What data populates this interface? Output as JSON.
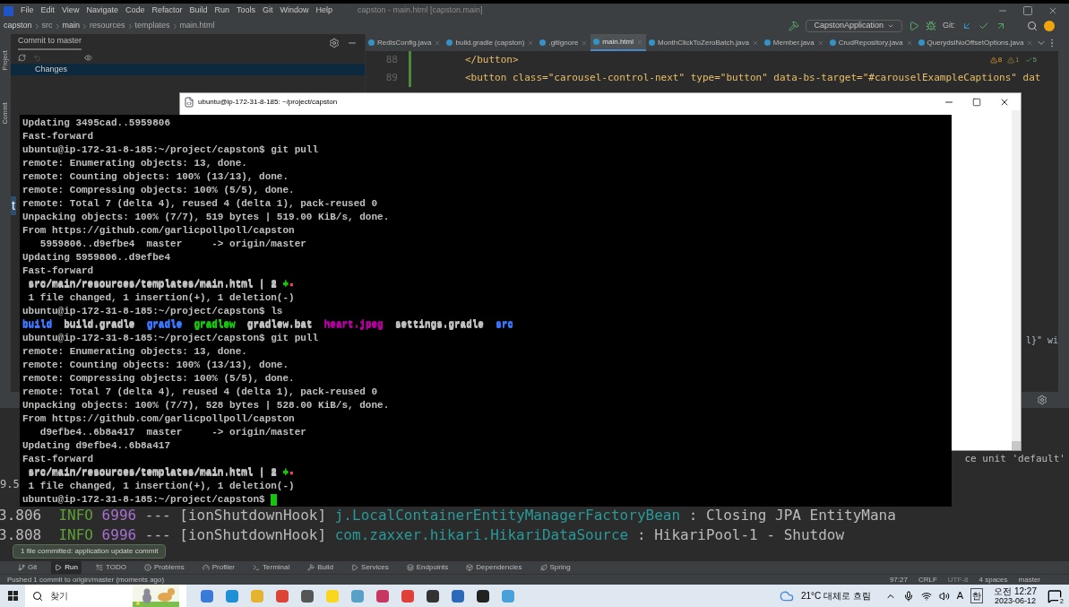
{
  "ide": {
    "menu": [
      "File",
      "Edit",
      "View",
      "Navigate",
      "Code",
      "Refactor",
      "Build",
      "Run",
      "Tools",
      "Git",
      "Window",
      "Help"
    ],
    "window_title": "capston - main.html [capston.main]",
    "breadcrumb": [
      "capston",
      "src",
      "main",
      "resources",
      "templates",
      "main.html"
    ],
    "run_config": "CapstonApplication",
    "git_label": "Git:",
    "side_tabs": [
      "Project",
      "Commit"
    ],
    "commit_panel": {
      "title": "Commit to master",
      "changes": "Changes"
    },
    "editor_tabs": [
      {
        "label": "RedisConfig.java",
        "selected": false
      },
      {
        "label": "build.gradle (capston)",
        "selected": false
      },
      {
        "label": ".gitignore",
        "selected": false
      },
      {
        "label": "main.html",
        "selected": true
      },
      {
        "label": "MonthClickToZeroBatch.java",
        "selected": false
      },
      {
        "label": "Member.java",
        "selected": false
      },
      {
        "label": "CrudRepository.java",
        "selected": false
      },
      {
        "label": "QuerydslNoOffsetOptions.java",
        "selected": false
      }
    ],
    "inspections": {
      "warnings": "8",
      "weak": "1",
      "ok": "5"
    },
    "code_lines": [
      {
        "number": "88",
        "text": "</button>"
      },
      {
        "number": "89",
        "text": "<button class=\"carousel-control-next\" type=\"button\" data-bs-target=\"#carouselExampleCaptions\" dat"
      }
    ],
    "code_fragment": "l}\" wi",
    "console_fragments": {
      "left_mark": "t",
      "unit": "ce unit 'default'",
      "time": "9.5"
    },
    "console_lines": [
      {
        "time": "3.806",
        "level": "INFO",
        "pid": "6996",
        "sep": "---",
        "thread": "[ionShutdownHook]",
        "logger": "j.LocalContainerEntityManagerFactoryBean",
        "message": ": Closing JPA EntityMana"
      },
      {
        "time": "3.808",
        "level": "INFO",
        "pid": "6996",
        "sep": "---",
        "thread": "[ionShutdownHook]",
        "logger": "com.zaxxer.hikari.HikariDataSource",
        "message": ": HikariPool-1 - Shutdow"
      }
    ],
    "tooltip": "1 file committed: application update commit",
    "tool_tabs": [
      {
        "label": "Git",
        "selected": false
      },
      {
        "label": "Run",
        "selected": true
      },
      {
        "label": "TODO",
        "selected": false
      },
      {
        "label": "Problems",
        "selected": false
      },
      {
        "label": "Profiler",
        "selected": false
      },
      {
        "label": "Terminal",
        "selected": false
      },
      {
        "label": "Build",
        "selected": false
      },
      {
        "label": "Services",
        "selected": false
      },
      {
        "label": "Endpoints",
        "selected": false
      },
      {
        "label": "Dependencies",
        "selected": false
      },
      {
        "label": "Spring",
        "selected": false
      }
    ],
    "status": {
      "message": "Pushed 1 commit to origin/master (moments ago)",
      "position": "97:27",
      "line_sep": "CRLF",
      "encoding": "UTF-8",
      "indent": "4 spaces",
      "branch": "master"
    }
  },
  "terminal": {
    "title": "ubuntu@ip-172-31-8-185: ~/project/capston",
    "lines": [
      [
        {
          "text": "Updating 3495cad..5959806"
        }
      ],
      [
        {
          "text": "Fast-forward"
        }
      ],
      [
        {
          "text": "ubuntu@ip-172-31-8-185:~/project/capston$ git pull"
        }
      ],
      [
        {
          "text": "remote: Enumerating objects: 13, done."
        }
      ],
      [
        {
          "text": "remote: Counting objects: 100% (13/13), done."
        }
      ],
      [
        {
          "text": "remote: Compressing objects: 100% (5/5), done."
        }
      ],
      [
        {
          "text": "remote: Total 7 (delta 4), reused 4 (delta 1), pack-reused 0"
        }
      ],
      [
        {
          "text": "Unpacking objects: 100% (7/7), 519 bytes | 519.00 KiB/s, done."
        }
      ],
      [
        {
          "text": "From https://github.com/garlicpollpoll/capston"
        }
      ],
      [
        {
          "text": "   5959806..d9efbe4  master     -> origin/master"
        }
      ],
      [
        {
          "text": "Updating 5959806..d9efbe4"
        }
      ],
      [
        {
          "text": "Fast-forward"
        }
      ],
      [
        {
          "text": " src/main/resources/templates/main.html | 2 ",
          "color": "#c0c0c0"
        },
        {
          "text": "+",
          "color": "#16c60c"
        },
        {
          "text": "-",
          "color": "#e74856"
        }
      ],
      [
        {
          "text": " 1 file changed, 1 insertion(+), 1 deletion(-)"
        }
      ],
      [
        {
          "text": "ubuntu@ip-172-31-8-185:~/project/capston$ ls"
        }
      ],
      [
        {
          "text": "build",
          "color": "#3b78ff"
        },
        {
          "text": "  build.gradle  ",
          "color": "#c0c0c0"
        },
        {
          "text": "gradle",
          "color": "#3b78ff"
        },
        {
          "text": "  gradlew",
          "color": "#16c60c"
        },
        {
          "text": "  gradlew.bat  ",
          "color": "#c0c0c0"
        },
        {
          "text": "heart.jpeg",
          "color": "#b4009e"
        },
        {
          "text": "  settings.gradle  ",
          "color": "#c0c0c0"
        },
        {
          "text": "src",
          "color": "#3b78ff"
        }
      ],
      [
        {
          "text": "ubuntu@ip-172-31-8-185:~/project/capston$ git pull"
        }
      ],
      [
        {
          "text": "remote: Enumerating objects: 13, done."
        }
      ],
      [
        {
          "text": "remote: Counting objects: 100% (13/13), done."
        }
      ],
      [
        {
          "text": "remote: Compressing objects: 100% (5/5), done."
        }
      ],
      [
        {
          "text": "remote: Total 7 (delta 4), reused 4 (delta 1), pack-reused 0"
        }
      ],
      [
        {
          "text": "Unpacking objects: 100% (7/7), 528 bytes | 528.00 KiB/s, done."
        }
      ],
      [
        {
          "text": "From https://github.com/garlicpollpoll/capston"
        }
      ],
      [
        {
          "text": "   d9efbe4..6b8a417  master     -> origin/master"
        }
      ],
      [
        {
          "text": "Updating d9efbe4..6b8a417"
        }
      ],
      [
        {
          "text": "Fast-forward"
        }
      ],
      [
        {
          "text": " src/main/resources/templates/main.html | 2 ",
          "color": "#c0c0c0"
        },
        {
          "text": "+",
          "color": "#16c60c"
        },
        {
          "text": "-",
          "color": "#e74856"
        }
      ],
      [
        {
          "text": " 1 file changed, 1 insertion(+), 1 deletion(-)"
        }
      ],
      [
        {
          "text": "ubuntu@ip-172-31-8-185:~/project/capston$ "
        }
      ]
    ]
  },
  "taskbar": {
    "search_placeholder": "찾기",
    "weather": "21°C 대체로 흐림",
    "ime": "A",
    "hangul": "한",
    "time": "오전 12:27",
    "date": "2023-06-12",
    "notifications": "2"
  }
}
